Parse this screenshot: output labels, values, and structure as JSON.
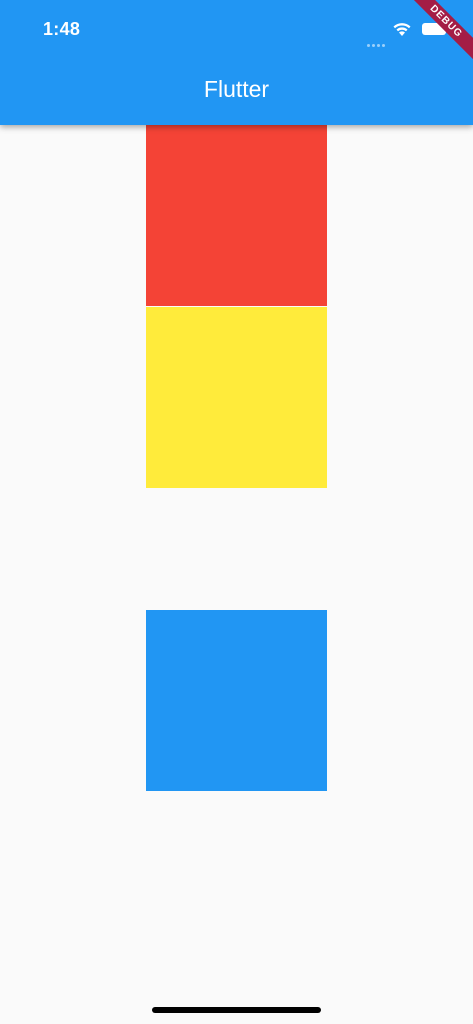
{
  "status_bar": {
    "time": "1:48"
  },
  "debug_banner": {
    "label": "DEBUG"
  },
  "app_bar": {
    "title": "Flutter",
    "color": "#2196f3"
  },
  "boxes": [
    {
      "color_name": "red",
      "color": "#f44336"
    },
    {
      "color_name": "yellow",
      "color": "#ffeb3b"
    },
    {
      "color_name": "blue",
      "color": "#2196f3"
    }
  ],
  "background_color": "#fafafa"
}
